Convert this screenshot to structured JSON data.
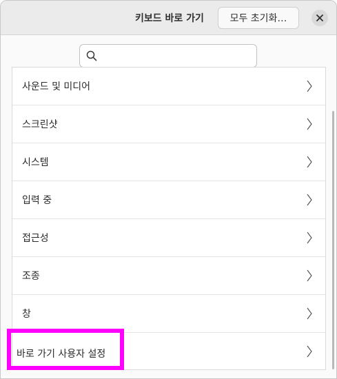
{
  "header": {
    "title": "키보드 바로 가기",
    "reset_label": "모두 초기화…",
    "close_icon": "close-icon"
  },
  "search": {
    "placeholder": "",
    "value": "",
    "icon": "search-icon"
  },
  "list": {
    "items": [
      {
        "label": "사운드 및 미디어"
      },
      {
        "label": "스크린샷"
      },
      {
        "label": "시스템"
      },
      {
        "label": "입력 중"
      },
      {
        "label": "접근성"
      },
      {
        "label": "조종"
      },
      {
        "label": "창"
      },
      {
        "label": "바로 가기 사용자 설정"
      }
    ]
  },
  "colors": {
    "highlight": "#ff00ff",
    "header_bg": "#ebebeb"
  }
}
